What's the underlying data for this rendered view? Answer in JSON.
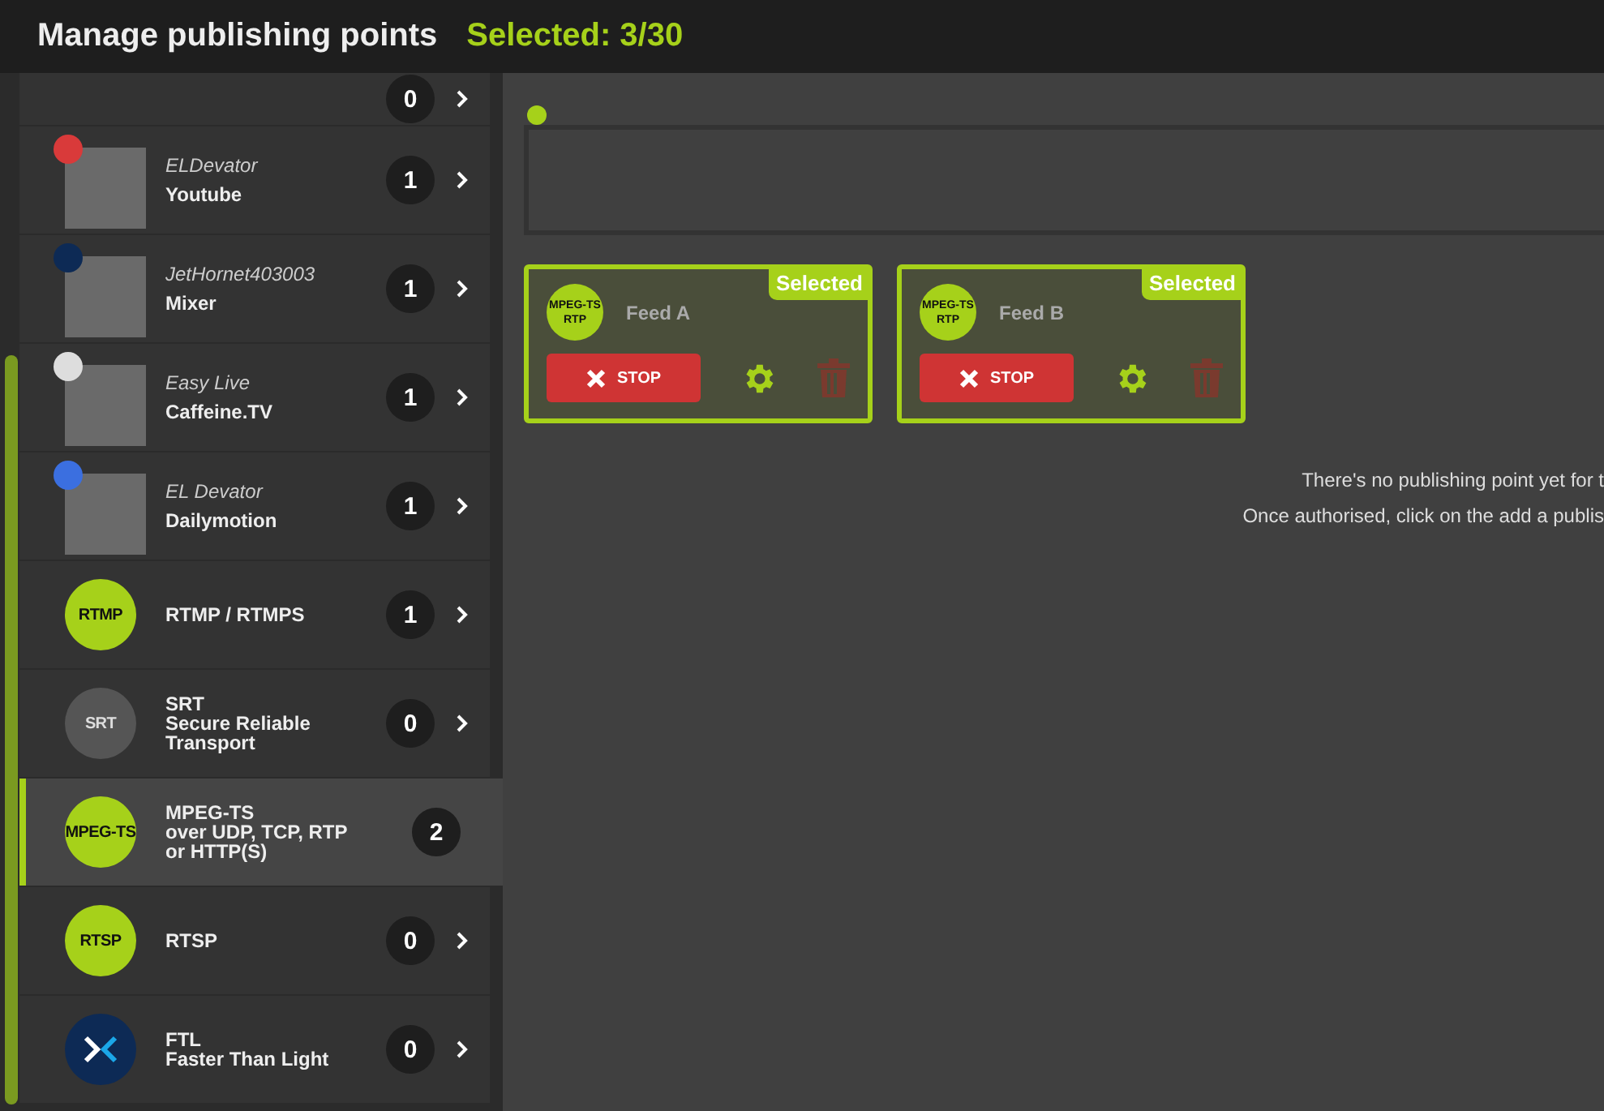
{
  "header": {
    "title": "Manage publishing points",
    "selection": "Selected: 3/30"
  },
  "sidebar": {
    "items": [
      {
        "kind": "partial",
        "count": "0",
        "selected": false
      },
      {
        "kind": "account",
        "color": "#d93a3a",
        "account": "ELDevator",
        "name": "Youtube",
        "count": "1",
        "selected": false
      },
      {
        "kind": "account",
        "color": "#0d2a55",
        "account": "JetHornet403003",
        "name": "Mixer",
        "count": "1",
        "selected": false
      },
      {
        "kind": "account",
        "color": "#dddddd",
        "account": "Easy Live",
        "name": "Caffeine.TV",
        "count": "1",
        "selected": false
      },
      {
        "kind": "account",
        "color": "#3b6fe0",
        "account": "EL Devator",
        "name": "Dailymotion",
        "count": "1",
        "selected": false
      },
      {
        "kind": "protocol",
        "badge": "RTMP",
        "lines": [
          "RTMP / RTMPS"
        ],
        "count": "1",
        "selected": false
      },
      {
        "kind": "protocol",
        "badge": "SRT",
        "dark": true,
        "lines": [
          "SRT",
          "Secure Reliable",
          "Transport"
        ],
        "count": "0",
        "selected": false
      },
      {
        "kind": "protocol",
        "badge": "MPEG-TS",
        "lines": [
          "MPEG-TS",
          "over UDP, TCP, RTP",
          "or HTTP(S)"
        ],
        "count": "2",
        "selected": true
      },
      {
        "kind": "protocol",
        "badge": "RTSP",
        "lines": [
          "RTSP"
        ],
        "count": "0",
        "selected": false
      },
      {
        "kind": "ftl",
        "lines": [
          "FTL",
          "Faster Than Light"
        ],
        "count": "0",
        "selected": false
      }
    ]
  },
  "cards": [
    {
      "badge": [
        "MPEG-TS",
        "RTP"
      ],
      "name": "Feed A",
      "tag": "Selected",
      "stop": "STOP",
      "selected": true
    },
    {
      "badge": [
        "MPEG-TS",
        "RTP"
      ],
      "name": "Feed B",
      "tag": "Selected",
      "stop": "STOP",
      "selected": true
    }
  ],
  "empty_message": [
    "There's no publishing point yet for t",
    "Once authorised, click on the add a publis"
  ]
}
